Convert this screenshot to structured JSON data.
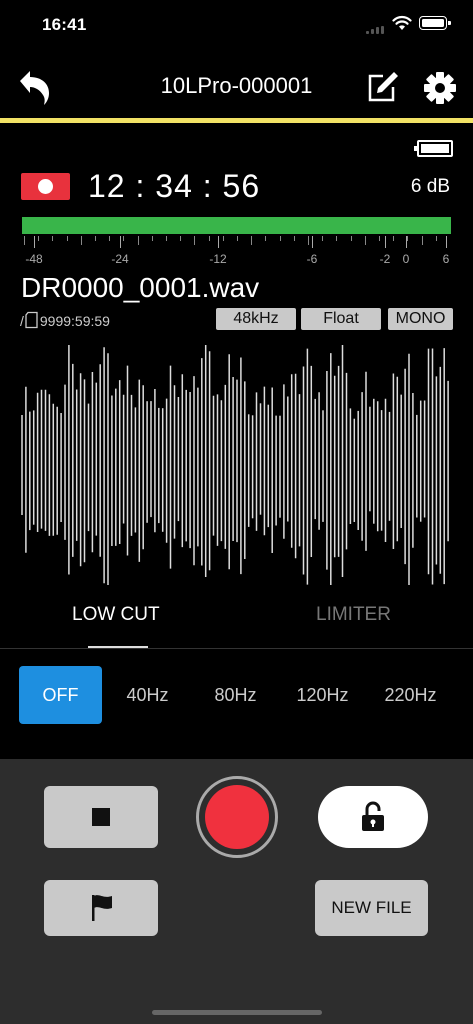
{
  "status_bar": {
    "time": "16:41"
  },
  "header": {
    "title": "10LPro-000001"
  },
  "recorder": {
    "elapsed_time": "12 : 34 : 56",
    "gain": "6 dB",
    "meter_scale": [
      "-48",
      "-24",
      "-12",
      "-6",
      "-2",
      "0",
      "6"
    ]
  },
  "file": {
    "name": "DR0000_0001.wav",
    "remain_prefix": "/",
    "remain_time": "9999:59:59",
    "sample_rate": "48kHz",
    "bit_depth": "Float",
    "channels": "MONO"
  },
  "tabs": {
    "low_cut": "LOW CUT",
    "limiter": "LIMITER"
  },
  "low_cut_options": [
    "OFF",
    "40Hz",
    "80Hz",
    "120Hz",
    "220Hz"
  ],
  "low_cut_selected": "OFF",
  "controls": {
    "new_file": "NEW FILE"
  },
  "colors": {
    "accent_line": "#f2e266",
    "meter": "#39b54a",
    "record": "#f0313e",
    "selected_option": "#1e8fe0"
  },
  "icons": [
    "back-arrow-icon",
    "edit-icon",
    "gear-icon",
    "battery-icon",
    "sd-card-icon",
    "stop-icon",
    "record-icon",
    "unlock-icon",
    "flag-icon"
  ]
}
